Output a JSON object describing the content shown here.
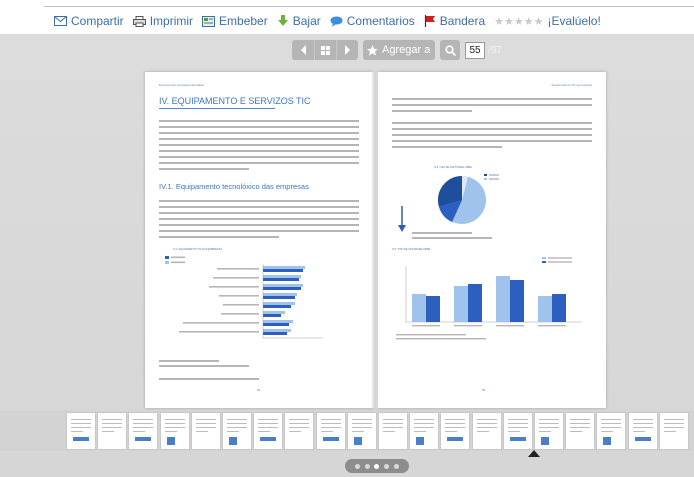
{
  "share_bar": {
    "items": [
      {
        "label": "Compartir",
        "icon": "mail-icon"
      },
      {
        "label": "Imprimir",
        "icon": "printer-icon"
      },
      {
        "label": "Embeber",
        "icon": "embed-icon"
      },
      {
        "label": "Bajar",
        "icon": "download-arrow-icon"
      },
      {
        "label": "Comentarios",
        "icon": "comment-bubble-icon"
      },
      {
        "label": "Bandera",
        "icon": "flag-icon"
      }
    ],
    "rating_stars": "★★★★★",
    "rating_label": "¡Evalúelo!"
  },
  "toolbar": {
    "add_label": "Agregar a",
    "current_page": "55",
    "total_pages": "/97"
  },
  "left_page": {
    "running_head": "Encuesta sobre tecnologías informáticas",
    "heading": "IV. EQUIPAMENTO E SERVIZOS TIC",
    "subheading": "IV.1. Equipamento tecnolóxico das empresas",
    "chart_caption": "IV.1. EQUIPAMENTO TIC NAS EMPRESAS",
    "page_number": "54"
  },
  "right_page": {
    "running_head": "Enquisa sobre as TIC nas empresas",
    "chart1_caption": "IV.2. USO DE SOFTWARE LIBRE",
    "chart2_caption": "IV.3. TIPO DE SOFTWARE LIBRE",
    "page_number": "55"
  },
  "colors": {
    "accent_blue": "#3d76c2",
    "chart_blue": "#2c5fbf",
    "chart_light": "#9fc3ea",
    "link_blue": "#3d6ea8"
  },
  "pager": {
    "dots": 5,
    "active": 3
  }
}
